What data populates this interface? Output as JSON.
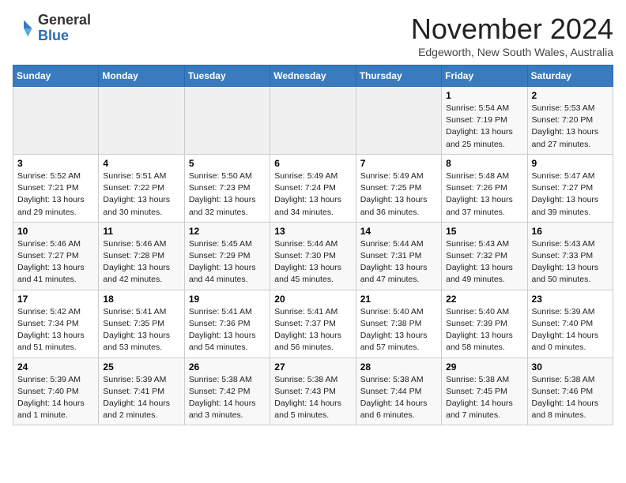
{
  "logo": {
    "general": "General",
    "blue": "Blue"
  },
  "header": {
    "month": "November 2024",
    "location": "Edgeworth, New South Wales, Australia"
  },
  "days_of_week": [
    "Sunday",
    "Monday",
    "Tuesday",
    "Wednesday",
    "Thursday",
    "Friday",
    "Saturday"
  ],
  "weeks": [
    [
      {
        "day": "",
        "info": ""
      },
      {
        "day": "",
        "info": ""
      },
      {
        "day": "",
        "info": ""
      },
      {
        "day": "",
        "info": ""
      },
      {
        "day": "",
        "info": ""
      },
      {
        "day": "1",
        "info": "Sunrise: 5:54 AM\nSunset: 7:19 PM\nDaylight: 13 hours and 25 minutes."
      },
      {
        "day": "2",
        "info": "Sunrise: 5:53 AM\nSunset: 7:20 PM\nDaylight: 13 hours and 27 minutes."
      }
    ],
    [
      {
        "day": "3",
        "info": "Sunrise: 5:52 AM\nSunset: 7:21 PM\nDaylight: 13 hours and 29 minutes."
      },
      {
        "day": "4",
        "info": "Sunrise: 5:51 AM\nSunset: 7:22 PM\nDaylight: 13 hours and 30 minutes."
      },
      {
        "day": "5",
        "info": "Sunrise: 5:50 AM\nSunset: 7:23 PM\nDaylight: 13 hours and 32 minutes."
      },
      {
        "day": "6",
        "info": "Sunrise: 5:49 AM\nSunset: 7:24 PM\nDaylight: 13 hours and 34 minutes."
      },
      {
        "day": "7",
        "info": "Sunrise: 5:49 AM\nSunset: 7:25 PM\nDaylight: 13 hours and 36 minutes."
      },
      {
        "day": "8",
        "info": "Sunrise: 5:48 AM\nSunset: 7:26 PM\nDaylight: 13 hours and 37 minutes."
      },
      {
        "day": "9",
        "info": "Sunrise: 5:47 AM\nSunset: 7:27 PM\nDaylight: 13 hours and 39 minutes."
      }
    ],
    [
      {
        "day": "10",
        "info": "Sunrise: 5:46 AM\nSunset: 7:27 PM\nDaylight: 13 hours and 41 minutes."
      },
      {
        "day": "11",
        "info": "Sunrise: 5:46 AM\nSunset: 7:28 PM\nDaylight: 13 hours and 42 minutes."
      },
      {
        "day": "12",
        "info": "Sunrise: 5:45 AM\nSunset: 7:29 PM\nDaylight: 13 hours and 44 minutes."
      },
      {
        "day": "13",
        "info": "Sunrise: 5:44 AM\nSunset: 7:30 PM\nDaylight: 13 hours and 45 minutes."
      },
      {
        "day": "14",
        "info": "Sunrise: 5:44 AM\nSunset: 7:31 PM\nDaylight: 13 hours and 47 minutes."
      },
      {
        "day": "15",
        "info": "Sunrise: 5:43 AM\nSunset: 7:32 PM\nDaylight: 13 hours and 49 minutes."
      },
      {
        "day": "16",
        "info": "Sunrise: 5:43 AM\nSunset: 7:33 PM\nDaylight: 13 hours and 50 minutes."
      }
    ],
    [
      {
        "day": "17",
        "info": "Sunrise: 5:42 AM\nSunset: 7:34 PM\nDaylight: 13 hours and 51 minutes."
      },
      {
        "day": "18",
        "info": "Sunrise: 5:41 AM\nSunset: 7:35 PM\nDaylight: 13 hours and 53 minutes."
      },
      {
        "day": "19",
        "info": "Sunrise: 5:41 AM\nSunset: 7:36 PM\nDaylight: 13 hours and 54 minutes."
      },
      {
        "day": "20",
        "info": "Sunrise: 5:41 AM\nSunset: 7:37 PM\nDaylight: 13 hours and 56 minutes."
      },
      {
        "day": "21",
        "info": "Sunrise: 5:40 AM\nSunset: 7:38 PM\nDaylight: 13 hours and 57 minutes."
      },
      {
        "day": "22",
        "info": "Sunrise: 5:40 AM\nSunset: 7:39 PM\nDaylight: 13 hours and 58 minutes."
      },
      {
        "day": "23",
        "info": "Sunrise: 5:39 AM\nSunset: 7:40 PM\nDaylight: 14 hours and 0 minutes."
      }
    ],
    [
      {
        "day": "24",
        "info": "Sunrise: 5:39 AM\nSunset: 7:40 PM\nDaylight: 14 hours and 1 minute."
      },
      {
        "day": "25",
        "info": "Sunrise: 5:39 AM\nSunset: 7:41 PM\nDaylight: 14 hours and 2 minutes."
      },
      {
        "day": "26",
        "info": "Sunrise: 5:38 AM\nSunset: 7:42 PM\nDaylight: 14 hours and 3 minutes."
      },
      {
        "day": "27",
        "info": "Sunrise: 5:38 AM\nSunset: 7:43 PM\nDaylight: 14 hours and 5 minutes."
      },
      {
        "day": "28",
        "info": "Sunrise: 5:38 AM\nSunset: 7:44 PM\nDaylight: 14 hours and 6 minutes."
      },
      {
        "day": "29",
        "info": "Sunrise: 5:38 AM\nSunset: 7:45 PM\nDaylight: 14 hours and 7 minutes."
      },
      {
        "day": "30",
        "info": "Sunrise: 5:38 AM\nSunset: 7:46 PM\nDaylight: 14 hours and 8 minutes."
      }
    ]
  ]
}
